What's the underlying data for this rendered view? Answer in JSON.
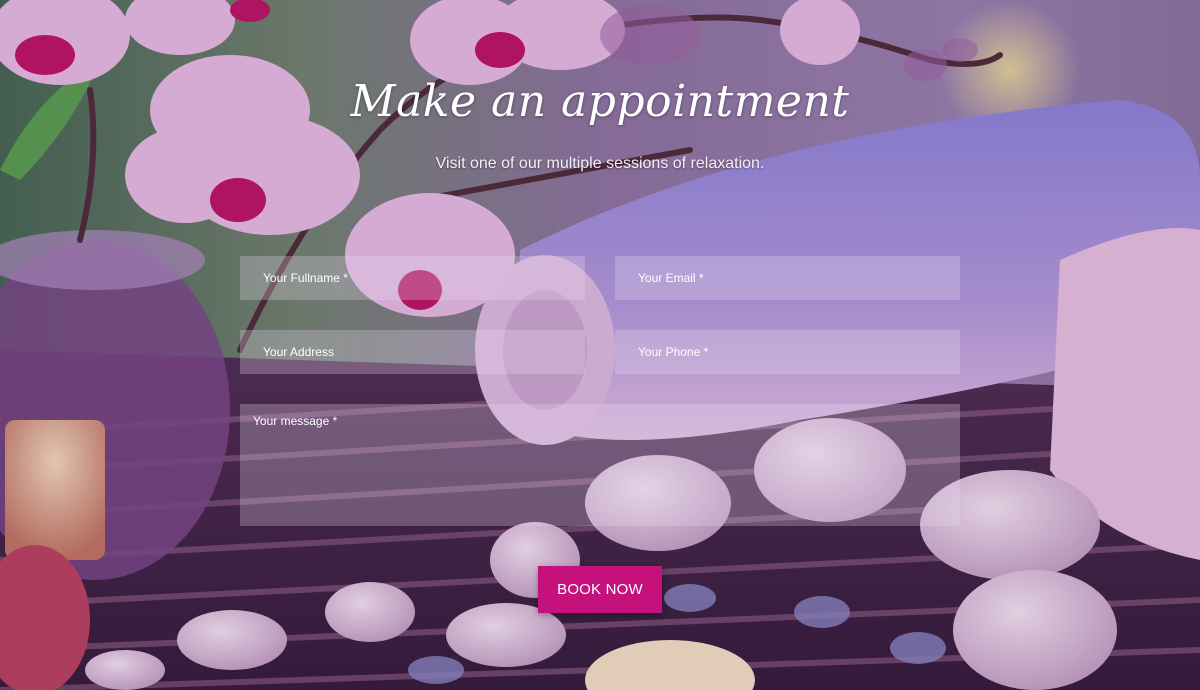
{
  "header": {
    "title": "Make an appointment",
    "subtitle": "Visit one of our multiple sessions of relaxation."
  },
  "form": {
    "fullname_placeholder": "Your Fullname *",
    "email_placeholder": "Your Email *",
    "address_placeholder": "Your Address",
    "phone_placeholder": "Your Phone *",
    "message_placeholder": "Your message *",
    "submit_label": "BOOK NOW"
  },
  "colors": {
    "accent": "#c4117c",
    "field_background": "rgba(235,220,240,0.28)",
    "text": "#ffffff"
  },
  "background": {
    "description_icon": "spa-background-image"
  }
}
